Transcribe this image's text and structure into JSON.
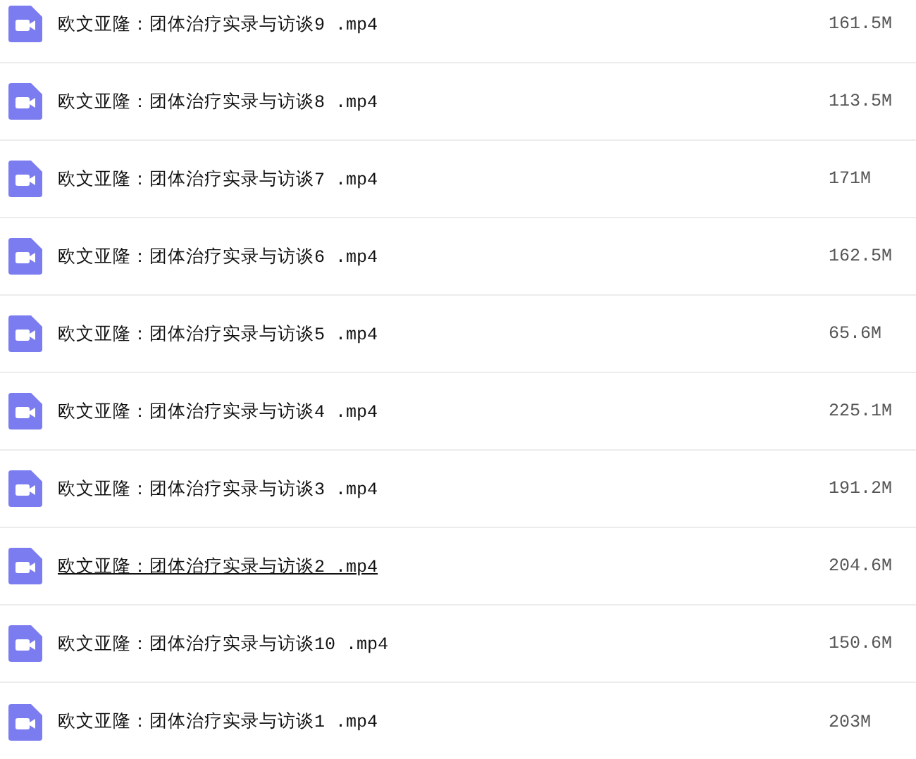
{
  "files": [
    {
      "name": "欧文亚隆：团体治疗实录与访谈9 .mp4",
      "size": "161.5M",
      "hovered": false
    },
    {
      "name": "欧文亚隆：团体治疗实录与访谈8 .mp4",
      "size": "113.5M",
      "hovered": false
    },
    {
      "name": "欧文亚隆：团体治疗实录与访谈7 .mp4",
      "size": "171M",
      "hovered": false
    },
    {
      "name": "欧文亚隆：团体治疗实录与访谈6 .mp4",
      "size": "162.5M",
      "hovered": false
    },
    {
      "name": "欧文亚隆：团体治疗实录与访谈5 .mp4",
      "size": "65.6M",
      "hovered": false
    },
    {
      "name": "欧文亚隆：团体治疗实录与访谈4 .mp4",
      "size": "225.1M",
      "hovered": false
    },
    {
      "name": "欧文亚隆：团体治疗实录与访谈3 .mp4",
      "size": "191.2M",
      "hovered": false
    },
    {
      "name": "欧文亚隆：团体治疗实录与访谈2 .mp4",
      "size": "204.6M",
      "hovered": true
    },
    {
      "name": "欧文亚隆：团体治疗实录与访谈10 .mp4",
      "size": "150.6M",
      "hovered": false
    },
    {
      "name": "欧文亚隆：团体治疗实录与访谈1 .mp4",
      "size": "203M",
      "hovered": false
    }
  ]
}
